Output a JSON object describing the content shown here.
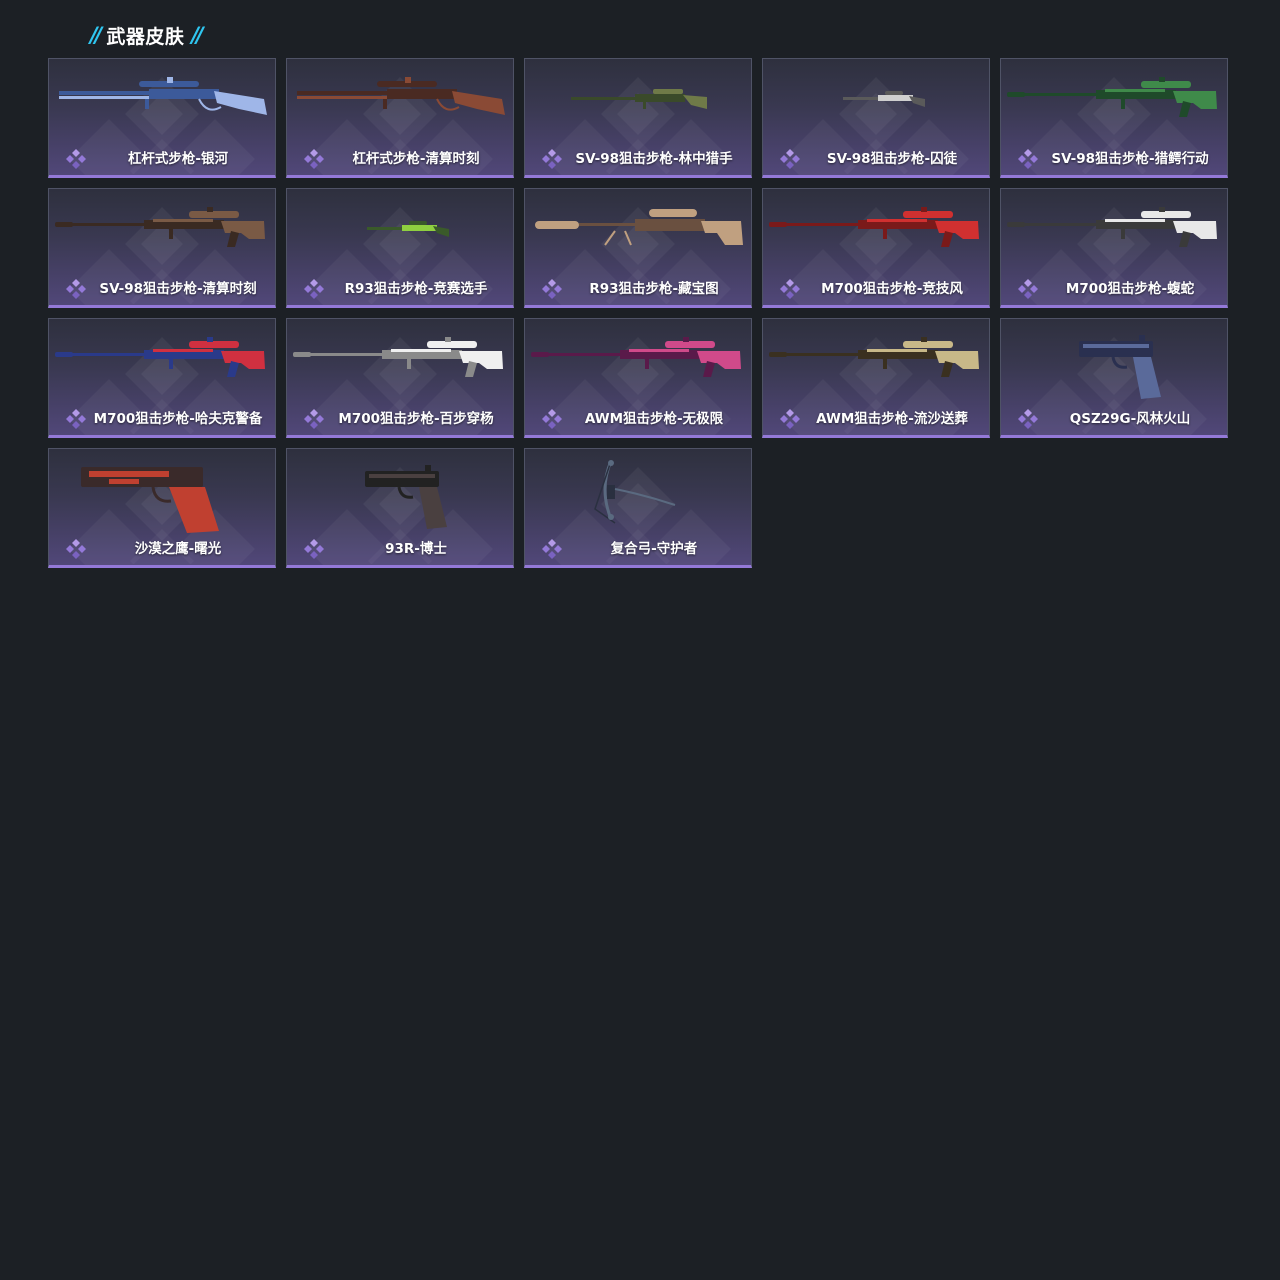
{
  "section": {
    "title": "武器皮肤",
    "slash_left": "//",
    "slash_right": "//"
  },
  "colors": {
    "background": "#1c2025",
    "accent_cyan": "#2fc6f0",
    "rarity_purple": "#9479d8"
  },
  "items": [
    {
      "label": "杠杆式步枪-银河",
      "icon": "lever-rifle-icon",
      "art": "rifle",
      "c1": "#3c5a9a",
      "c2": "#9fb6e8"
    },
    {
      "label": "杠杆式步枪-清算时刻",
      "icon": "lever-rifle-icon",
      "art": "rifle",
      "c1": "#4a2a22",
      "c2": "#8a4a35"
    },
    {
      "label": "SV-98狙击步枪-林中猎手",
      "icon": "sniper-rifle-icon",
      "art": "sniper-small",
      "c1": "#3a4a2a",
      "c2": "#6f7a48"
    },
    {
      "label": "SV-98狙击步枪-囚徒",
      "icon": "sniper-rifle-icon",
      "art": "sniper-tiny",
      "c1": "#5a5a5a",
      "c2": "#cfcfcf"
    },
    {
      "label": "SV-98狙击步枪-猎鳄行动",
      "icon": "sniper-rifle-icon",
      "art": "sniper",
      "c1": "#1f4a2a",
      "c2": "#3f8a4a"
    },
    {
      "label": "SV-98狙击步枪-清算时刻",
      "icon": "sniper-rifle-icon",
      "art": "sniper",
      "c1": "#3a2a22",
      "c2": "#7a5a45"
    },
    {
      "label": "R93狙击步枪-竞赛选手",
      "icon": "sniper-rifle-icon",
      "art": "sniper-tiny",
      "c1": "#3a5a2a",
      "c2": "#8fd040"
    },
    {
      "label": "R93狙击步枪-藏宝图",
      "icon": "sniper-rifle-icon",
      "art": "sniper-heavy",
      "c1": "#6a5040",
      "c2": "#c0a080"
    },
    {
      "label": "M700狙击步枪-竞技风",
      "icon": "sniper-rifle-icon",
      "art": "sniper",
      "c1": "#7a1a1a",
      "c2": "#d03030"
    },
    {
      "label": "M700狙击步枪-蝮蛇",
      "icon": "sniper-rifle-icon",
      "art": "sniper",
      "c1": "#3a3a3a",
      "c2": "#e8e8e8"
    },
    {
      "label": "M700狙击步枪-哈夫克警备",
      "icon": "sniper-rifle-icon",
      "art": "sniper",
      "c1": "#2a3a8a",
      "c2": "#d03040"
    },
    {
      "label": "M700狙击步枪-百步穿杨",
      "icon": "sniper-rifle-icon",
      "art": "sniper",
      "c1": "#8a8a8a",
      "c2": "#f0f0f0"
    },
    {
      "label": "AWM狙击步枪-无极限",
      "icon": "sniper-rifle-icon",
      "art": "sniper",
      "c1": "#5a1a4a",
      "c2": "#d04a8a"
    },
    {
      "label": "AWM狙击步枪-流沙送葬",
      "icon": "sniper-rifle-icon",
      "art": "sniper",
      "c1": "#3a3020",
      "c2": "#c8b888"
    },
    {
      "label": "QSZ29G-风林火山",
      "icon": "pistol-icon",
      "art": "pistol",
      "c1": "#2a3050",
      "c2": "#5a6a9a"
    },
    {
      "label": "沙漠之鹰-曙光",
      "icon": "pistol-icon",
      "art": "deagle",
      "c1": "#3a2a2a",
      "c2": "#c04030"
    },
    {
      "label": "93R-博士",
      "icon": "pistol-icon",
      "art": "pistol",
      "c1": "#222222",
      "c2": "#4a4040"
    },
    {
      "label": "复合弓-守护者",
      "icon": "compound-bow-icon",
      "art": "bow",
      "c1": "#2a3040",
      "c2": "#5a6a80"
    }
  ]
}
